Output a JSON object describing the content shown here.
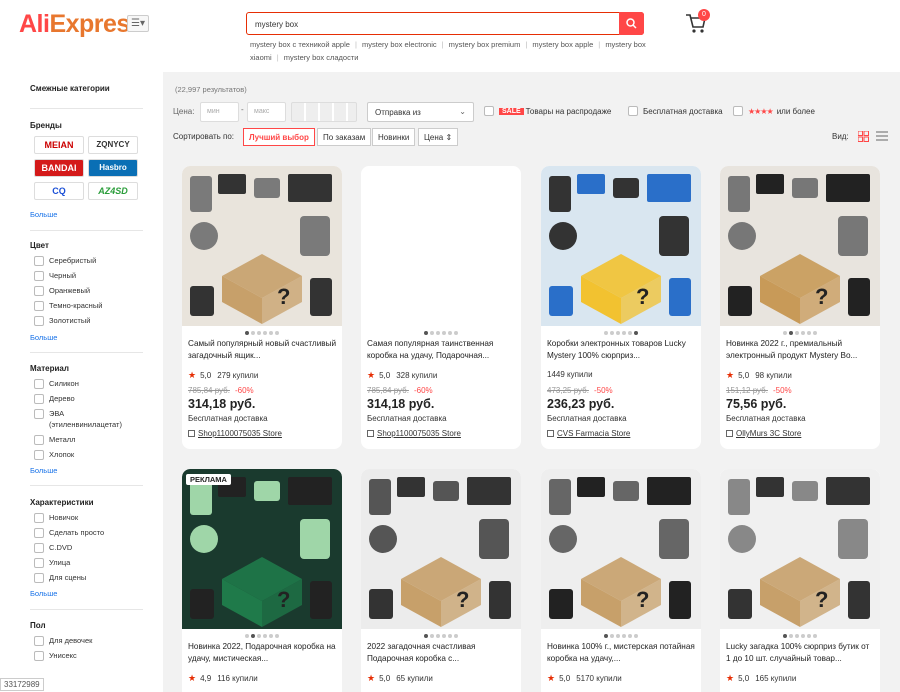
{
  "header": {
    "logo_ali": "Ali",
    "logo_express": "Express",
    "search_value": "mystery box",
    "cart_count": "0",
    "suggestions": [
      "mystery box с техникой apple",
      "mystery box electronic",
      "mystery box premium",
      "mystery box apple",
      "mystery box xiaomi",
      "mystery box сладости"
    ]
  },
  "sidebar": {
    "related": "Смежные категории",
    "brands_title": "Бренды",
    "brands": [
      "MEIAN",
      "ZQNYCY",
      "BANDAI",
      "Hasbro",
      "CQ",
      "AZ4SD"
    ],
    "more": "Больше",
    "color_title": "Цвет",
    "colors": [
      "Серебристый",
      "Черный",
      "Оранжевый",
      "Темно-красный",
      "Золотистый"
    ],
    "material_title": "Материал",
    "materials": [
      "Силикон",
      "Дерево",
      "ЭВА",
      "(этиленвинилацетат)",
      "Металл",
      "Хлопок"
    ],
    "features_title": "Характеристики",
    "features": [
      "Новичок",
      "Сделать просто",
      "C.DVD",
      "Улица",
      "Для сцены"
    ],
    "gender_title": "Пол",
    "genders": [
      "Для девочек",
      "Унисекс"
    ]
  },
  "main": {
    "results": "(22,997 результатов)",
    "price_label": "Цена:",
    "min_placeholder": "мин",
    "max_placeholder": "макс",
    "ship_from": "Отправка из",
    "sale_tag": "SALE",
    "sale_label": "Товары на распродаже",
    "free_ship": "Бесплатная доставка",
    "stars": "★★★★",
    "or_more": "или более",
    "sort_label": "Сортировать по:",
    "sort_options": [
      "Лучший выбор",
      "По заказам",
      "Новинки",
      "Цена ⇕"
    ],
    "view_label": "Вид:"
  },
  "products": [
    {
      "title": "Самый популярный новый счастливый загадочный ящик...",
      "rating": "5,0",
      "sold": "279 купили",
      "old_price": "785,84 руб.",
      "discount": "-60%",
      "price": "314,18 руб.",
      "shipping": "Бесплатная доставка",
      "store": "Shop1100075035 Store"
    },
    {
      "title": "Самая популярная таинственная коробка на удачу, Подарочная...",
      "rating": "5,0",
      "sold": "328 купили",
      "old_price": "785,84 руб.",
      "discount": "-60%",
      "price": "314,18 руб.",
      "shipping": "Бесплатная доставка",
      "store": "Shop1100075035 Store"
    },
    {
      "title": "Коробки электронных товаров Lucky Mystery 100% сюрприз...",
      "rating": "",
      "sold": "1449 купили",
      "old_price": "473,25 руб.",
      "discount": "-50%",
      "price": "236,23 руб.",
      "shipping": "Бесплатная доставка",
      "store": "CVS Farmacia Store"
    },
    {
      "title": "Новинка 2022 г., премиальный электронный продукт Mystery Bo...",
      "rating": "5,0",
      "sold": "98 купили",
      "old_price": "151,12 руб.",
      "discount": "-50%",
      "price": "75,56 руб.",
      "shipping": "Бесплатная доставка",
      "store": "OllyMurs 3C Store"
    },
    {
      "title": "Новинка 2022, Подарочная коробка на удачу, мистическая...",
      "rating": "4,9",
      "sold": "116 купили",
      "ad": "РЕКЛАМА"
    },
    {
      "title": "2022 загадочная счастливая Подарочная коробка с...",
      "rating": "5,0",
      "sold": "65 купили"
    },
    {
      "title": "Новинка 100% г., мистерская потайная коробка на удачу,...",
      "rating": "5,0",
      "sold": "5170 купили"
    },
    {
      "title": "Lucky загадка 100% сюрприз бутик от 1 до 10 шт. случайный товар...",
      "rating": "5,0",
      "sold": "165 купили"
    }
  ],
  "watermark": "33172989",
  "colors": {
    "accent": "#ff4747",
    "bg": "#f2f2f2"
  }
}
